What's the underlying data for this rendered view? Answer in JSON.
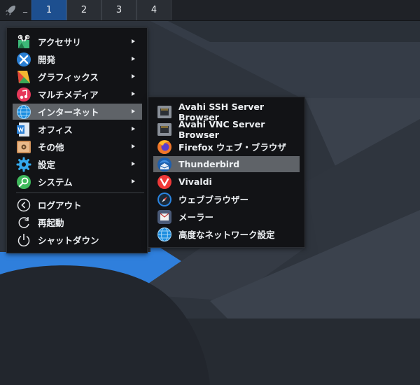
{
  "panel": {
    "workspaces": [
      "1",
      "2",
      "3",
      "4"
    ],
    "minimize_mark": "_",
    "active_workspace": "1"
  },
  "main_menu": {
    "items": [
      {
        "label": "アクセサリ",
        "icon": "accessories-icon",
        "submenu": true
      },
      {
        "label": "開発",
        "icon": "development-icon",
        "submenu": true
      },
      {
        "label": "グラフィックス",
        "icon": "graphics-icon",
        "submenu": true
      },
      {
        "label": "マルチメディア",
        "icon": "multimedia-icon",
        "submenu": true
      },
      {
        "label": "インターネット",
        "icon": "internet-icon",
        "submenu": true,
        "selected": true
      },
      {
        "label": "オフィス",
        "icon": "office-icon",
        "submenu": true
      },
      {
        "label": "その他",
        "icon": "other-icon",
        "submenu": true
      },
      {
        "label": "設定",
        "icon": "settings-icon",
        "submenu": true
      },
      {
        "label": "システム",
        "icon": "system-icon",
        "submenu": true
      }
    ],
    "session_items": [
      {
        "label": "ログアウト",
        "icon": "logout-icon"
      },
      {
        "label": "再起動",
        "icon": "restart-icon"
      },
      {
        "label": "シャットダウン",
        "icon": "shutdown-icon"
      }
    ]
  },
  "sub_menu": {
    "items": [
      {
        "label": "Avahi SSH Server Browser",
        "icon": "network-server-icon"
      },
      {
        "label": "Avahi VNC Server Browser",
        "icon": "network-server-icon"
      },
      {
        "label": "Firefox ウェブ・ブラウザ",
        "icon": "firefox-icon"
      },
      {
        "label": "Thunderbird",
        "icon": "thunderbird-icon",
        "selected": true
      },
      {
        "label": "Vivaldi",
        "icon": "vivaldi-icon"
      },
      {
        "label": "ウェブブラウザー",
        "icon": "web-browser-icon"
      },
      {
        "label": "メーラー",
        "icon": "mailer-icon"
      },
      {
        "label": "高度なネットワーク設定",
        "icon": "network-settings-icon"
      }
    ]
  },
  "colors": {
    "menu_bg": "#121316",
    "selected_bg": "#5f6368",
    "active_workspace": "#1d4f8f",
    "wallpaper_blue": "#2f7fdc"
  }
}
